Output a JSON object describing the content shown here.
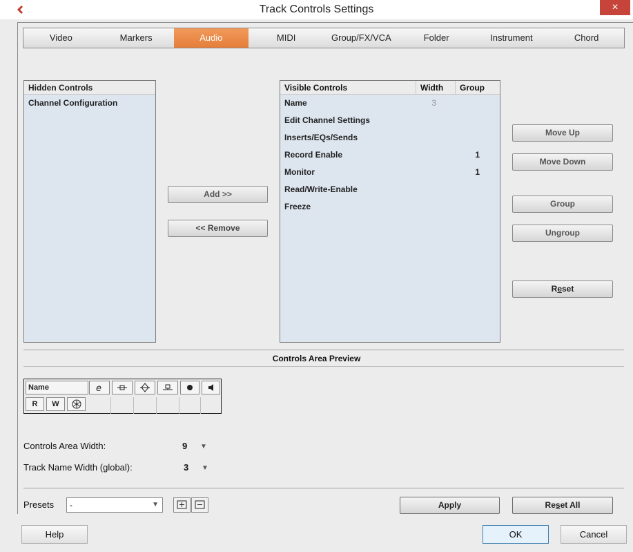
{
  "window": {
    "title": "Track Controls Settings",
    "close_glyph": "×"
  },
  "tabs": [
    {
      "label": "Video",
      "active": false
    },
    {
      "label": "Markers",
      "active": false
    },
    {
      "label": "Audio",
      "active": true
    },
    {
      "label": "MIDI",
      "active": false
    },
    {
      "label": "Group/FX/VCA",
      "active": false
    },
    {
      "label": "Folder",
      "active": false
    },
    {
      "label": "Instrument",
      "active": false
    },
    {
      "label": "Chord",
      "active": false
    }
  ],
  "hidden_controls": {
    "header": "Hidden Controls",
    "items": [
      "Channel Configuration"
    ]
  },
  "visible_controls": {
    "headers": {
      "name": "Visible Controls",
      "width": "Width",
      "group": "Group"
    },
    "rows": [
      {
        "name": "Name",
        "width": "3",
        "group": ""
      },
      {
        "name": "Edit Channel Settings",
        "width": "",
        "group": ""
      },
      {
        "name": "Inserts/EQs/Sends",
        "width": "",
        "group": ""
      },
      {
        "name": "Record Enable",
        "width": "",
        "group": "1"
      },
      {
        "name": "Monitor",
        "width": "",
        "group": "1"
      },
      {
        "name": "Read/Write-Enable",
        "width": "",
        "group": ""
      },
      {
        "name": "Freeze",
        "width": "",
        "group": ""
      }
    ]
  },
  "buttons": {
    "add": "Add >>",
    "remove": "<< Remove",
    "move_up": "Move Up",
    "move_down": "Move Down",
    "group": "Group",
    "ungroup": "Ungroup",
    "reset_pre": "R",
    "reset_ul": "e",
    "reset_post": "set",
    "apply": "Apply",
    "reset_all_pre": "Re",
    "reset_all_ul": "s",
    "reset_all_post": "et All",
    "help": "Help",
    "ok": "OK",
    "cancel": "Cancel"
  },
  "preview": {
    "title": "Controls Area Preview",
    "name_label": "Name",
    "r_label": "R",
    "w_label": "W"
  },
  "settings": {
    "controls_area_width_label": "Controls Area Width:",
    "controls_area_width_value": "9",
    "track_name_width_label": "Track Name Width (global):",
    "track_name_width_value": "3"
  },
  "presets": {
    "label": "Presets",
    "value": "-"
  },
  "colors": {
    "accent": "#e8873f",
    "list_bg": "#dde5ef",
    "close": "#c7443a"
  }
}
